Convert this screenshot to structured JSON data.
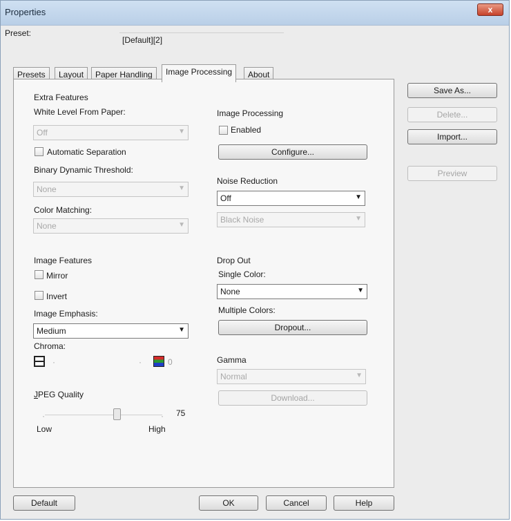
{
  "window": {
    "title": "Properties",
    "close_label": "x"
  },
  "preset": {
    "label": "Preset:",
    "value": "[Default][2]"
  },
  "tabs": [
    {
      "label": "Presets",
      "active": false
    },
    {
      "label": "Layout",
      "active": false
    },
    {
      "label": "Paper Handling",
      "active": false
    },
    {
      "label": "Image Processing",
      "active": true
    },
    {
      "label": "About",
      "active": false
    }
  ],
  "left": {
    "extra_features": "Extra Features",
    "white_level_label": "White Level From Paper:",
    "white_level_value": "Off",
    "automatic_separation": "Automatic Separation",
    "binary_threshold_label": "Binary Dynamic Threshold:",
    "binary_threshold_value": "None",
    "color_matching_label": "Color Matching:",
    "color_matching_value": "None",
    "image_features": "Image Features",
    "mirror": "Mirror",
    "invert": "Invert",
    "emphasis_label": "Image Emphasis:",
    "emphasis_value": "Medium",
    "chroma_label": "Chroma:",
    "chroma_scale": "0",
    "jpeg_label": "JPEG Quality",
    "jpeg_value": "75",
    "jpeg_fraction": 0.62,
    "jpeg_low": "Low",
    "jpeg_high": "High"
  },
  "right": {
    "image_processing_label": "Image Processing",
    "enabled": "Enabled",
    "configure": "Configure...",
    "noise_label": "Noise Reduction",
    "noise_value": "Off",
    "noise_sub_value": "Black Noise",
    "dropout_label": "Drop Out",
    "single_color_label": "Single Color:",
    "single_color_value": "None",
    "multiple_colors_label": "Multiple Colors:",
    "dropout_button": "Dropout...",
    "gamma_label": "Gamma",
    "gamma_value": "Normal",
    "download_button": "Download..."
  },
  "side": {
    "save_as": "Save As...",
    "delete": "Delete...",
    "import": "Import...",
    "preview": "Preview"
  },
  "bottom": {
    "default": "Default",
    "ok": "OK",
    "cancel": "Cancel",
    "help": "Help"
  }
}
